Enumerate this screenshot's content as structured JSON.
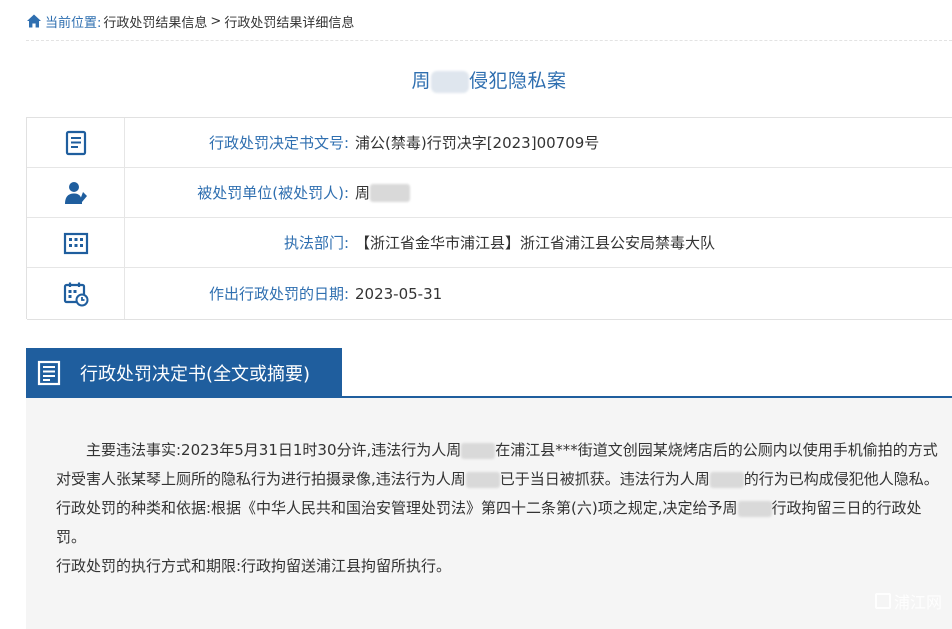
{
  "breadcrumb": {
    "current_label": "当前位置:",
    "items": [
      "行政处罚结果信息",
      "行政处罚结果详细信息"
    ],
    "separator": ">"
  },
  "case": {
    "title_prefix": "周",
    "title_suffix": "侵犯隐私案"
  },
  "info": {
    "rows": [
      {
        "icon": "document-icon",
        "label": "行政处罚决定书文号:",
        "value": "浦公(禁毒)行罚决字[2023]00709号"
      },
      {
        "icon": "person-icon",
        "label": "被处罚单位(被处罚人):",
        "value": "周"
      },
      {
        "icon": "building-icon",
        "label": "执法部门:",
        "value": "【浙江省金华市浦江县】浙江省浦江县公安局禁毒大队"
      },
      {
        "icon": "calendar-clock-icon",
        "label": "作出行政处罚的日期:",
        "value": "2023-05-31"
      }
    ]
  },
  "section": {
    "title": "行政处罚决定书(全文或摘要)"
  },
  "decision": {
    "p1_a": "主要违法事实:2023年5月31日1时30分许,违法行为人周",
    "p1_b": "在浦江县***街道文创园某烧烤店后的公厕内以使用手机偷拍的方式对受害人张某琴上厕所的隐私行为进行拍摄录像,违法行为人周",
    "p1_c": "已于当日被抓获。违法行为人周",
    "p1_d": "的行为已构成侵犯他人隐私。",
    "p2_a": "行政处罚的种类和依据:根据《中华人民共和国治安管理处罚法》第四十二条第(六)项之规定,决定给予周",
    "p2_b": "行政拘留三日的行政处罚。",
    "p3": "行政处罚的执行方式和期限:行政拘留送浦江县拘留所执行。"
  },
  "watermark": {
    "text": "浦江网"
  },
  "colors": {
    "accent": "#2f6fb0",
    "section_bg": "#1f5e9e",
    "body_bg": "#f5f5f5"
  }
}
